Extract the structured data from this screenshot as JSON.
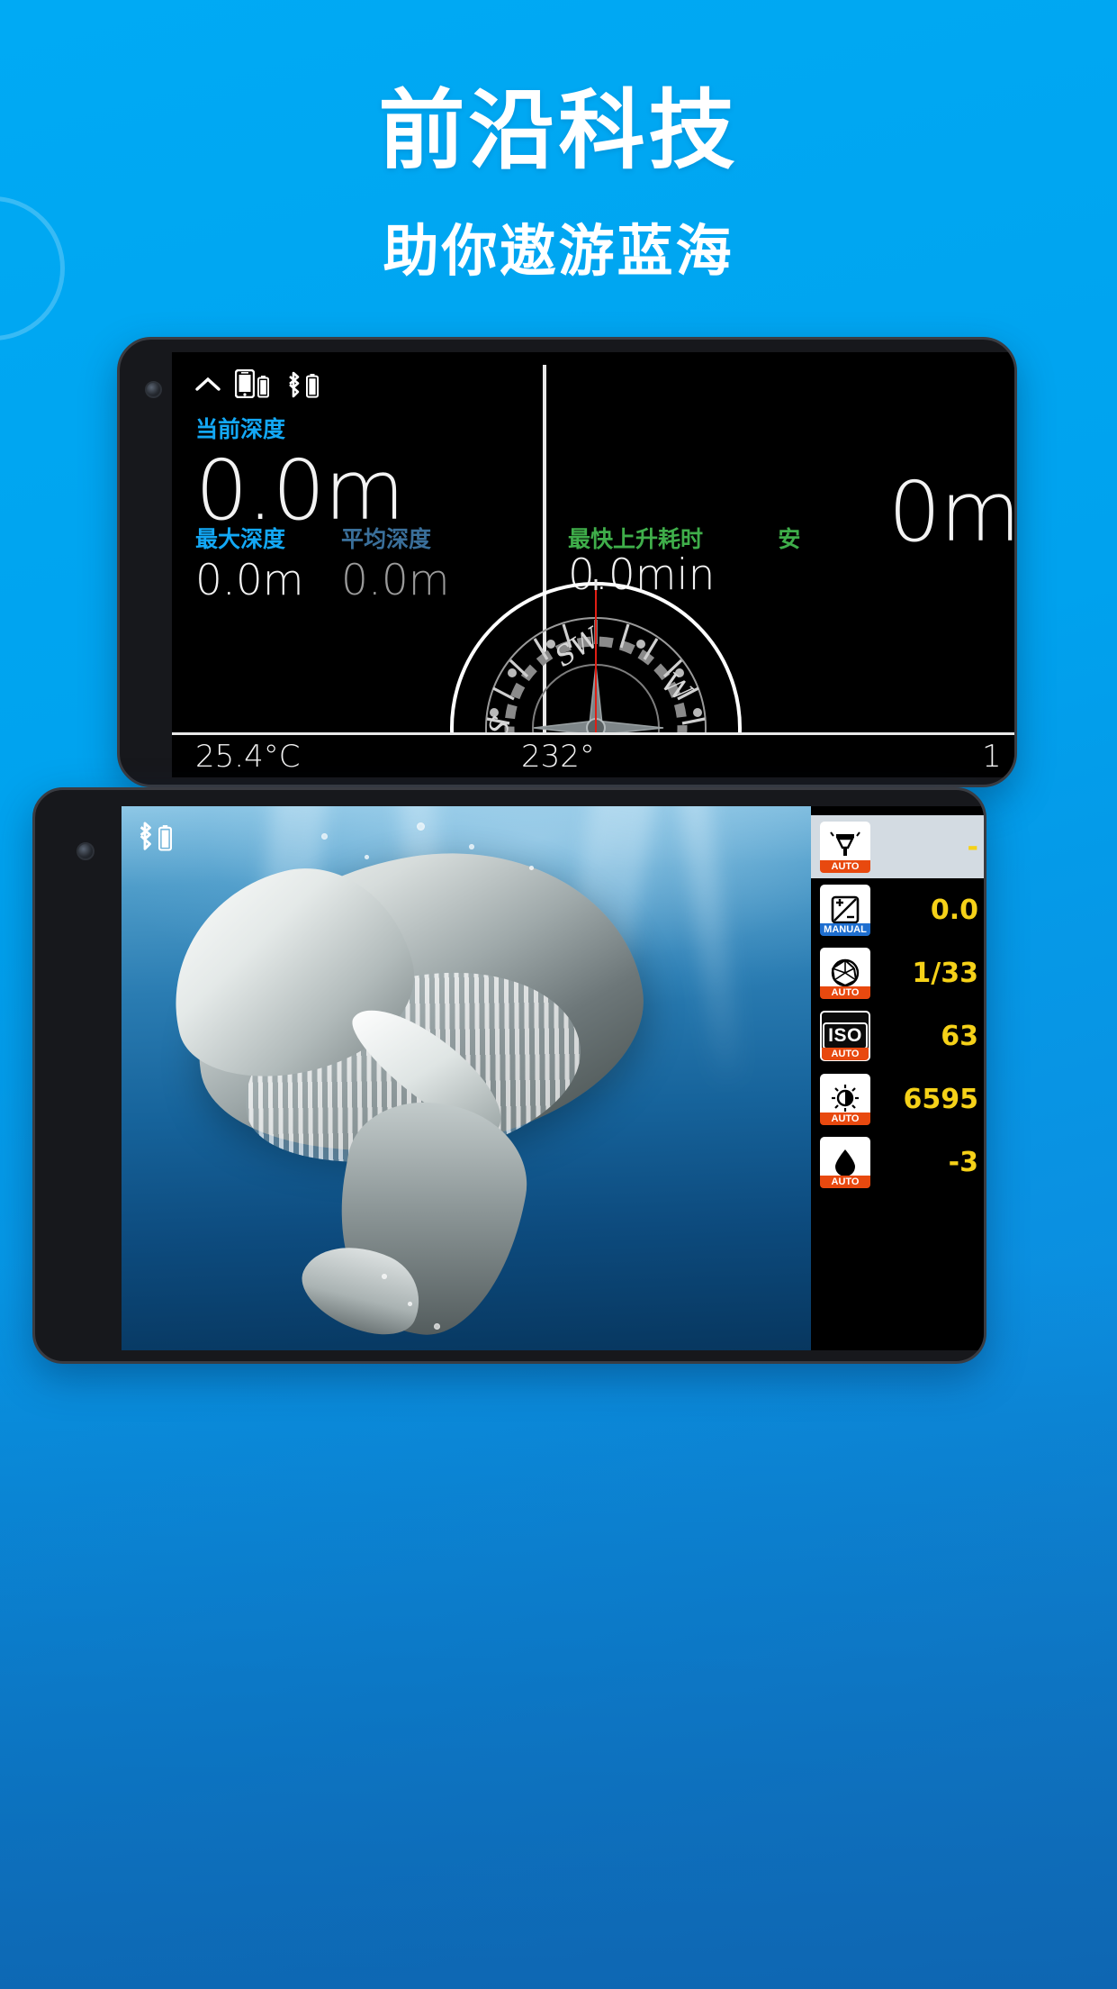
{
  "hero": {
    "headline": "前沿科技",
    "subhead": "助你遨游蓝海",
    "accent_color": "#00a6f0",
    "text_color": "#ffffff"
  },
  "dive_screen": {
    "status_icons": [
      "chevron-up-icon",
      "phone-battery-icon",
      "bluetooth-battery-icon"
    ],
    "current_depth": {
      "label": "当前深度",
      "value": "0.0m",
      "label_color": "#13a8f5"
    },
    "max_depth": {
      "label": "最大深度",
      "value": "0.0m",
      "label_color": "#13a8f5"
    },
    "avg_depth": {
      "label": "平均深度",
      "value": "0.0m",
      "label_color": "#3a6f9a"
    },
    "right_big": {
      "value": "0m"
    },
    "fastest_ascent": {
      "label": "最快上升耗时",
      "value": "0.0min",
      "label_color": "#3fae4a"
    },
    "right_extra_label": "安",
    "compass": {
      "markers": [
        "S",
        "SW",
        "W"
      ],
      "needle_color": "#e01e14"
    },
    "bottom_bar": {
      "temperature": "25.4°C",
      "heading": "232°",
      "third": "1"
    }
  },
  "camera_screen": {
    "bt_icon": "bluetooth-battery-icon",
    "settings": [
      {
        "icon": "flash-icon",
        "mode": "AUTO",
        "value": "-",
        "highlighted": true
      },
      {
        "icon": "exposure-comp-icon",
        "mode": "MANUAL",
        "value": "0.0",
        "highlighted": false
      },
      {
        "icon": "aperture-icon",
        "mode": "AUTO",
        "value": "1/33",
        "highlighted": false
      },
      {
        "icon": "iso-icon",
        "mode": "AUTO",
        "value": "63",
        "highlighted": false
      },
      {
        "icon": "white-balance-icon",
        "mode": "AUTO",
        "value": "6595",
        "highlighted": false
      },
      {
        "icon": "water-drop-icon",
        "mode": "AUTO",
        "value": "-3",
        "highlighted": false
      }
    ],
    "value_color": "#f5d118",
    "auto_tag_color": "#e8490f",
    "manual_tag_color": "#1f6fd0"
  }
}
